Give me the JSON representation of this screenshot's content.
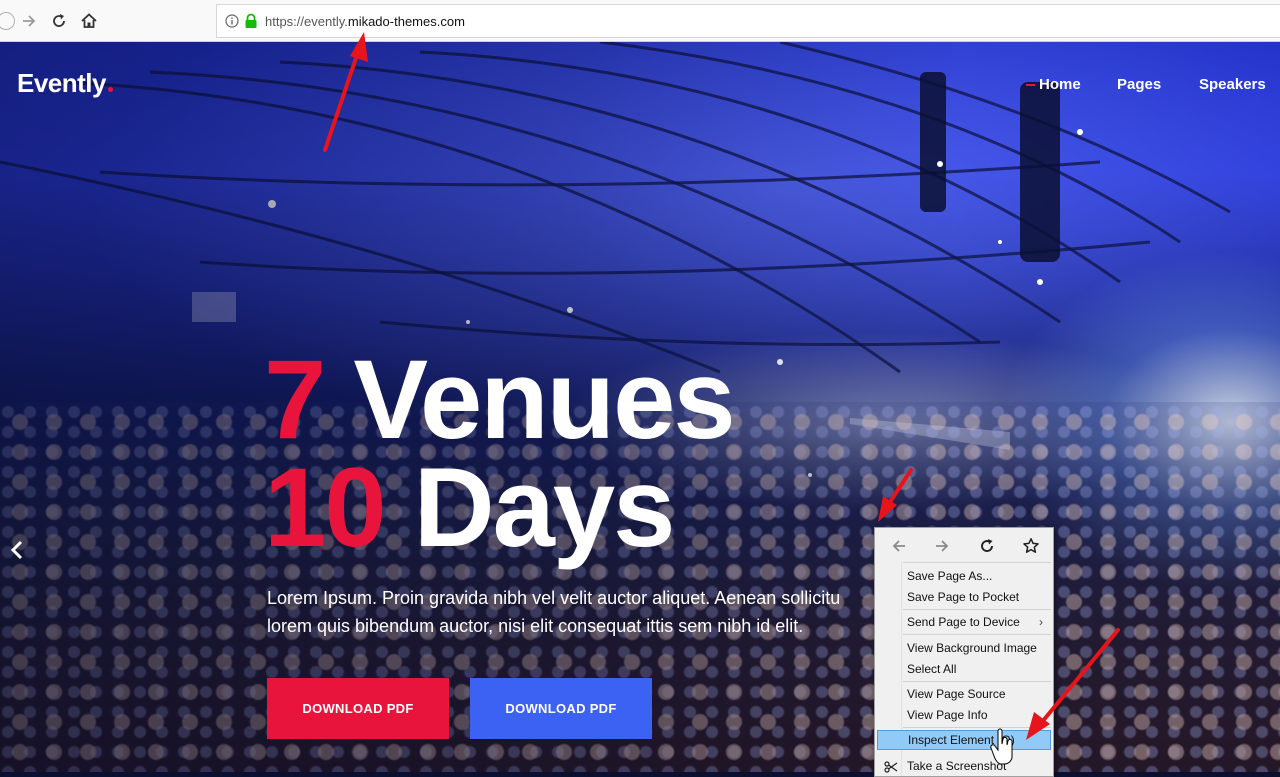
{
  "browser": {
    "url_prefix": "https://evently.",
    "url_domain": "mikado-themes.com",
    "back_icon": "back-arrow-icon",
    "forward_icon": "forward-arrow-icon",
    "reload_icon": "reload-icon",
    "home_icon": "home-icon"
  },
  "site": {
    "logo": "Evently",
    "nav": [
      "Home",
      "Pages",
      "Speakers"
    ],
    "active_nav": "Home"
  },
  "hero": {
    "line1_num": "7",
    "line1_text": "Venues",
    "line2_num": "10",
    "line2_text": "Days",
    "lead_line1": "Lorem Ipsum. Proin gravida nibh vel velit auctor aliquet. Aenean sollicitu",
    "lead_line2": "lorem quis bibendum auctor, nisi elit consequat ittis sem nibh id elit.",
    "button1": "DOWNLOAD PDF",
    "button2": "DOWNLOAD PDF"
  },
  "context_menu": {
    "items": [
      {
        "label": "Save Page As..."
      },
      {
        "label": "Save Page to Pocket"
      },
      {
        "label": "Send Page to Device",
        "submenu": "›"
      },
      {
        "label": "View Background Image"
      },
      {
        "label": "Select All"
      },
      {
        "label": "View Page Source"
      },
      {
        "label": "View Page Info"
      },
      {
        "label": "Inspect Element (Q)",
        "highlighted": true
      },
      {
        "label": "Take a Screenshot"
      }
    ]
  },
  "colors": {
    "accent_red": "#e8143c",
    "accent_blue": "#3b62f3",
    "annotation_arrow": "#e8141c",
    "menu_highlight": "#91c9f7"
  }
}
